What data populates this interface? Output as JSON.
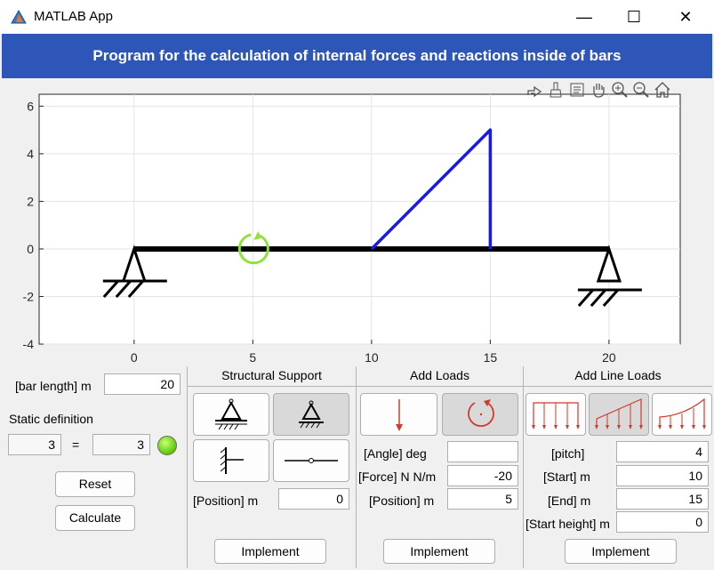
{
  "window": {
    "title": "MATLAB App",
    "minimize_glyph": "—",
    "maximize_glyph": "☐",
    "close_glyph": "✕"
  },
  "banner": {
    "text": "Program for the calculation of internal forces and reactions inside of bars",
    "background": "#2e55b8"
  },
  "axes_toolbar": {
    "icons": [
      "export-icon",
      "brush-icon",
      "datatip-icon",
      "pan-icon",
      "zoom-in-icon",
      "zoom-out-icon",
      "home-icon"
    ]
  },
  "chart_data": {
    "type": "line",
    "xlim": [
      -4,
      23
    ],
    "ylim": [
      -4,
      6.5
    ],
    "xticks": [
      0,
      5,
      10,
      15,
      20
    ],
    "xtick_labels": [
      "0",
      "5",
      "10",
      "15",
      "20"
    ],
    "yticks": [
      -4,
      -2,
      0,
      2,
      4,
      6
    ],
    "ytick_labels": [
      "-4",
      "-2",
      "0",
      "2",
      "4",
      "6"
    ],
    "grid": true,
    "series": [
      {
        "role": "bar",
        "color": "#000000",
        "x": [
          0,
          20
        ],
        "y": [
          0,
          0
        ]
      },
      {
        "role": "line-load",
        "color": "#1a1ae6",
        "x": [
          10,
          15,
          15
        ],
        "y": [
          0,
          5,
          0
        ]
      }
    ],
    "supports": [
      {
        "type": "pin",
        "x": 0
      },
      {
        "type": "roller",
        "x": 20
      }
    ],
    "moments": [
      {
        "x": 5,
        "y": 0,
        "color": "#8ee33a"
      }
    ]
  },
  "controls": {
    "bar_length_label": "[bar length] m",
    "bar_length_value": "20",
    "static_definition_label": "Static definition",
    "static_left": "3",
    "equals_sign": "=",
    "static_right": "3",
    "reset_label": "Reset",
    "calculate_label": "Calculate"
  },
  "structural_support": {
    "title": "Structural Support",
    "position_label": "[Position] m",
    "position_value": "0",
    "implement_label": "Implement"
  },
  "add_loads": {
    "title": "Add Loads",
    "angle_label": "[Angle] deg",
    "angle_value": "",
    "force_label": "[Force] N N/m",
    "force_value": "-20",
    "position_label": "[Position] m",
    "position_value": "5",
    "implement_label": "Implement"
  },
  "add_line_loads": {
    "title": "Add Line Loads",
    "pitch_label": "[pitch]",
    "pitch_value": "4",
    "start_label": "[Start] m",
    "start_value": "10",
    "end_label": "[End] m",
    "end_value": "15",
    "start_height_label": "[Start height] m",
    "start_height_value": "0",
    "implement_label": "Implement"
  }
}
